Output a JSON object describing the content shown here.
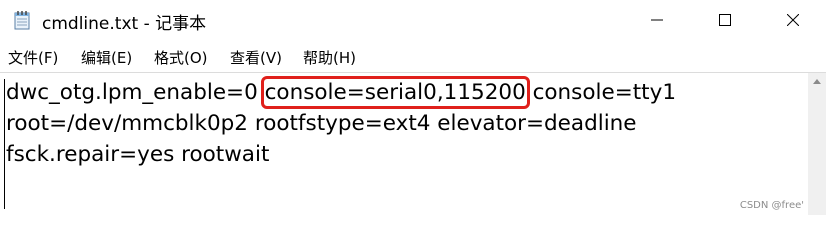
{
  "window": {
    "title": "cmdline.txt - 记事本"
  },
  "menu": {
    "items": [
      {
        "label": "文件(F)"
      },
      {
        "label": "编辑(E)"
      },
      {
        "label": "格式(O)"
      },
      {
        "label": "查看(V)"
      },
      {
        "label": "帮助(H)"
      }
    ]
  },
  "editor": {
    "line1_before": "dwc_otg.lpm_enable=0 ",
    "line1_highlight": "console=serial0,115200",
    "line1_after": " console=tty1",
    "line2": "root=/dev/mmcblk0p2 rootfstype=ext4 elevator=deadline",
    "line3": "fsck.repair=yes rootwait"
  },
  "watermark": "CSDN @free'",
  "colors": {
    "highlight_border": "#e0201b"
  },
  "icons": [
    "notepad-icon",
    "minimize-icon",
    "maximize-icon",
    "close-icon",
    "scroll-up-icon"
  ]
}
